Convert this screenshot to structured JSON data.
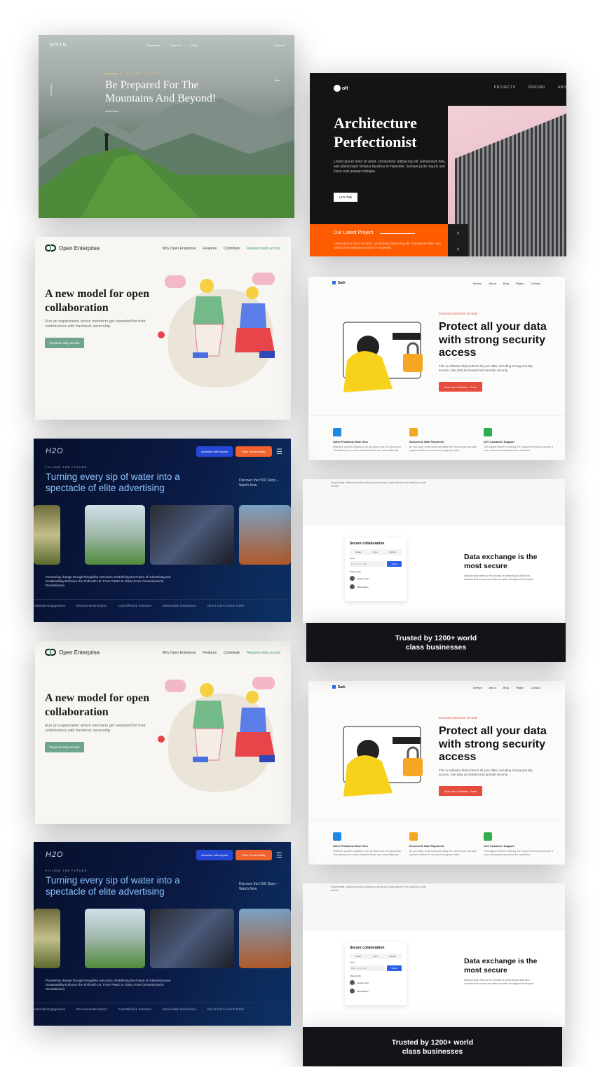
{
  "mntn": {
    "logo": "MNTN",
    "nav": [
      "Equipment",
      "About us",
      "Blog"
    ],
    "account": "Account",
    "eyebrow": "A HIKING GUIDE",
    "title": "Be Prepared For The Mountains And Beyond!",
    "scroll": "scroll down",
    "follow": "Follow us",
    "start": "Start"
  },
  "arch": {
    "logo": "olt",
    "nav": [
      "PROJECTS",
      "PRICING",
      "ABO"
    ],
    "title_line1": "Architecture",
    "title_line2": "Perfectionist",
    "description": "Lorem ipsum dolor sit amet, consectetur adipiscing elit. Elementum felis, sed ullamcorper tempus faucibus in imperdiet. Semper justo mauris sed fusce erat aenean tristique.",
    "cta": "Let's Talk",
    "latest_title": "Our Latest Project",
    "latest_desc": "Lorem ipsum dolor sit amet, consectetur adipiscing elit. Elementum felis, sed ullamcorper tempus faucibus in imperdiet.",
    "arrow_next": "›",
    "arrow_prev": "‹"
  },
  "oe": {
    "logo": "Open Enterprise",
    "nav": [
      "Why Open Enterprise",
      "Features",
      "Contribute"
    ],
    "nav_accent": "Request early access",
    "title": "A new model for open collaboration",
    "description": "Run an organization where members get rewarded for their contributions with fractional ownership.",
    "cta": "Request early access"
  },
  "sark": {
    "logo": "Sark",
    "nav": [
      "Demos",
      "About",
      "Blog",
      "Pages",
      "Contact"
    ],
    "tag": "Ensuring maximum security",
    "title": "Protect all your data with strong security access",
    "description": "This is software that protects all your data, including strong security access. Use data as needed and provide security.",
    "cta": "Scan Your Website - Free!",
    "features": [
      {
        "title": "Solve Problems Real Time",
        "desc": "Real-time problem solving is not just about time. It's about how. This allows you to solve problems faster and more efficiently.",
        "color": "#1e88e5"
      },
      {
        "title": "Secured & Safe Payments",
        "desc": "By and large, credit cards are easily the most secure and safe payment method to use when shopping online.",
        "color": "#f5a623"
      },
      {
        "title": "24/7 Customer Support",
        "desc": "The biggest benefit of offering 24/7 support is that you provide a more convenient experience for customers.",
        "color": "#2eae4e"
      }
    ]
  },
  "h2o": {
    "logo": "H2O",
    "btn_primary": "Advertise with Impact",
    "btn_secondary": "Start Sustainability",
    "menu": "☰",
    "eyebrow": "FILLING THE FUTURE",
    "title": "Turning every sip of water into a spectacle of elite advertising",
    "story": "Discover the H2O Story – Watch Now",
    "caption": "Pioneering change through thoughtful execution. Redefining the Future of Advertising and Sustainability.Embrace the Shift with Us: From Plastic to Glass,From Conventional to Revolutionary",
    "ticker": [
      "ustainabl Engagement",
      "Environmental Impact",
      "Cost-Effective Solutions",
      "Measurable Interactions",
      "Direct Call to Action Poten"
    ]
  },
  "slow": {
    "top_text": "firing threats. Website security software protects your data website from malicious cyber threats.",
    "card_title": "Secure collaboration",
    "tabs": [
      "Share",
      "Links",
      "Publish"
    ],
    "invite_label": "Invite",
    "invite_placeholder": "Enter your email",
    "invite_btn": "Share",
    "shared_label": "Shared with",
    "users": [
      "Jacquin Juan",
      "Jaliya Marco"
    ],
    "title": "Data exchange is the most secure",
    "description": "Data security refers to the process of protecting all data from unauthorized access and data corruption throughout its lifecycle."
  },
  "trusted": {
    "line1": "Trusted by 1200+ world",
    "line2": "class businesses"
  }
}
